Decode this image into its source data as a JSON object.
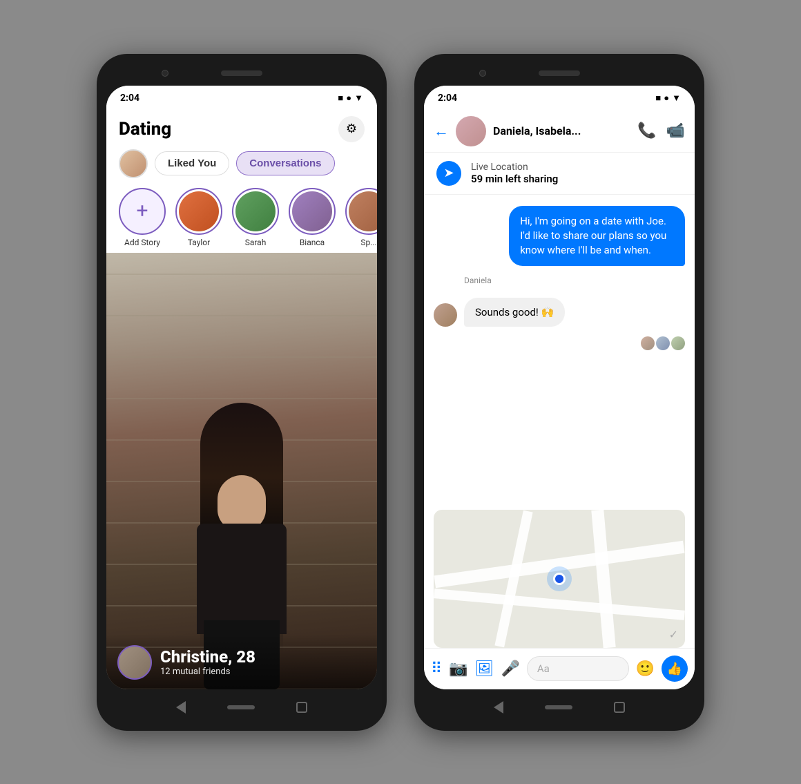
{
  "phone1": {
    "status_time": "2:04",
    "title": "Dating",
    "liked_you_tab": "Liked You",
    "conversations_tab": "Conversations",
    "stories": [
      {
        "label": "Add Story",
        "type": "add"
      },
      {
        "label": "Taylor",
        "type": "user",
        "color": "#e07040"
      },
      {
        "label": "Sarah",
        "type": "user",
        "color": "#60a060"
      },
      {
        "label": "Bianca",
        "type": "user",
        "color": "#a080c0"
      },
      {
        "label": "Sp...",
        "type": "user",
        "color": "#c08060"
      }
    ],
    "profile": {
      "name": "Christine, 28",
      "mutual": "12 mutual friends"
    }
  },
  "phone2": {
    "status_time": "2:04",
    "header_name": "Daniela, Isabela...",
    "live_location_title": "Live Location",
    "live_location_subtitle": "59 min left sharing",
    "message_out": "Hi, I'm going on a date with Joe. I'd like to share our plans so you know where I'll be and when.",
    "message_sender": "Daniela",
    "message_in": "Sounds good! 🙌",
    "input_placeholder": "Aa"
  }
}
